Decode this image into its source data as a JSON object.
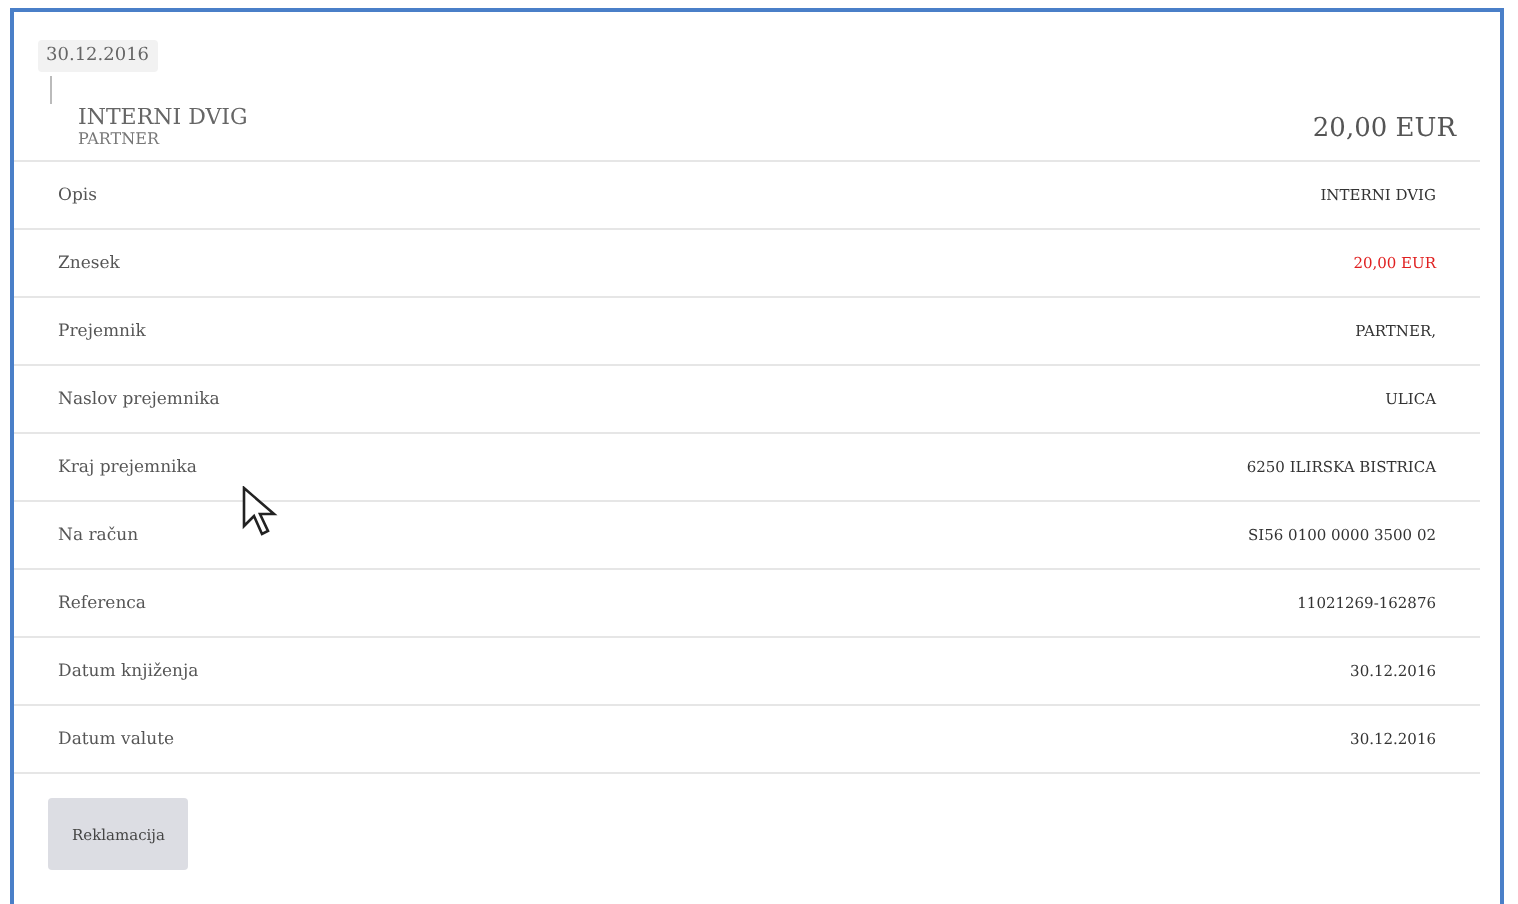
{
  "date": "30.12.2016",
  "header": {
    "title": "INTERNI DVIG",
    "subtitle": "PARTNER",
    "amount": "20,00 EUR"
  },
  "details": [
    {
      "label": "Opis",
      "value": "INTERNI DVIG",
      "kind": "plain"
    },
    {
      "label": "Znesek",
      "value": "20,00 EUR",
      "kind": "negative"
    },
    {
      "label": "Prejemnik",
      "value": "PARTNER,",
      "kind": "plain"
    },
    {
      "label": "Naslov prejemnika",
      "value": "ULICA",
      "kind": "plain"
    },
    {
      "label": "Kraj prejemnika",
      "value": "6250 ILIRSKA BISTRICA",
      "kind": "plain"
    },
    {
      "label": "Na račun",
      "value": "SI56 0100 0000 3500 02",
      "kind": "plain"
    },
    {
      "label": "Referenca",
      "value": "11021269-162876",
      "kind": "plain"
    },
    {
      "label": "Datum knjiženja",
      "value": "30.12.2016",
      "kind": "plain"
    },
    {
      "label": "Datum valute",
      "value": "30.12.2016",
      "kind": "plain"
    }
  ],
  "buttons": [
    "Reklamacija"
  ]
}
